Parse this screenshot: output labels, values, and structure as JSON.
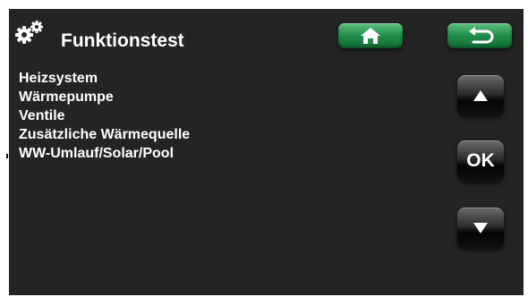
{
  "header": {
    "title": "Funktionstest",
    "icon": "gears-icon",
    "home_icon": "home-icon",
    "back_icon": "return-arrow-icon"
  },
  "menu": {
    "items": [
      {
        "label": "Heizsystem"
      },
      {
        "label": "Wärmepumpe"
      },
      {
        "label": "Ventile"
      },
      {
        "label": "Zusätzliche Wärmequelle"
      },
      {
        "label": "WW-Umlauf/Solar/Pool"
      }
    ]
  },
  "nav": {
    "up_icon": "triangle-up-icon",
    "ok_label": "OK",
    "down_icon": "triangle-down-icon"
  },
  "colors": {
    "panel": "#242424",
    "header_button": "#1f8a48",
    "text": "#ffffff"
  }
}
